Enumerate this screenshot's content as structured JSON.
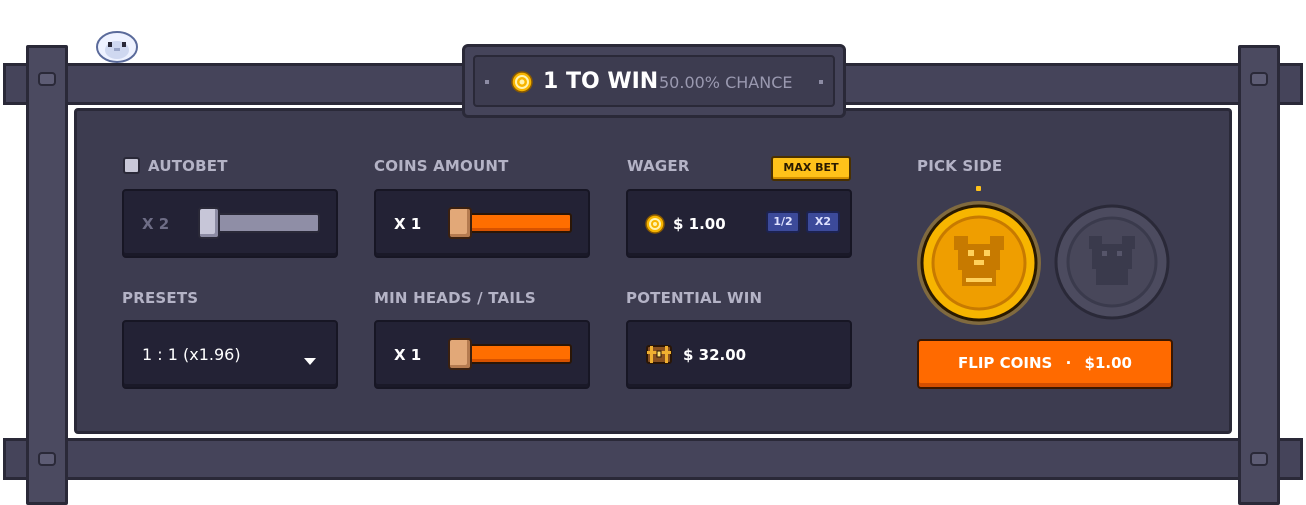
{
  "header": {
    "odds_label": "1 TO WIN",
    "chance_label": "50.00% CHANCE"
  },
  "autobet": {
    "label": "AUTOBET",
    "checked": false,
    "multiplier": "X 2"
  },
  "coins_amount": {
    "label": "COINS AMOUNT",
    "value": "X 1"
  },
  "wager": {
    "label": "WAGER",
    "max_bet_label": "MAX BET",
    "amount": "$ 1.00",
    "half_label": "1/2",
    "double_label": "X2"
  },
  "presets": {
    "label": "PRESETS",
    "selected": "1 : 1 (x1.96)"
  },
  "min_heads_tails": {
    "label": "MIN HEADS / TAILS",
    "value": "X 1"
  },
  "potential_win": {
    "label": "POTENTIAL WIN",
    "amount": "$ 32.00"
  },
  "pick_side": {
    "label": "PICK SIDE",
    "selected": "gold"
  },
  "flip_button": {
    "label": "FLIP COINS",
    "separator": "·",
    "amount": "$1.00"
  },
  "colors": {
    "accent_orange": "#ff6a00",
    "gold": "#f7b500",
    "panel": "#3d3c50",
    "field": "#232235"
  },
  "icons": [
    "mascot-icon",
    "coin-icon",
    "chevron-down-icon",
    "treasure-chest-icon",
    "bear-coin-icon"
  ]
}
